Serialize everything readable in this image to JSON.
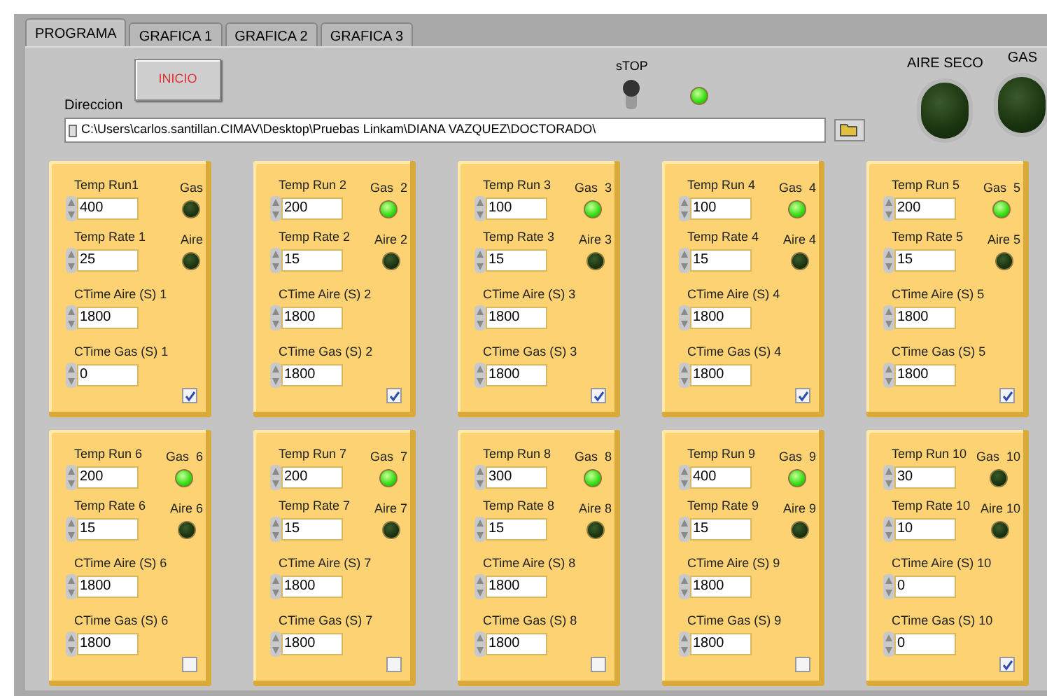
{
  "tabs": [
    {
      "label": "PROGRAMA",
      "selected": true
    },
    {
      "label": "GRAFICA 1",
      "selected": false
    },
    {
      "label": "GRAFICA 2",
      "selected": false
    },
    {
      "label": "GRAFICA 3",
      "selected": false
    }
  ],
  "start_button": "INICIO",
  "stop_switch": {
    "label": "sTOP",
    "on": false
  },
  "stop_led": {
    "on": true
  },
  "path": {
    "label": "Direccion",
    "value": "C:\\Users\\carlos.santillan.CIMAV\\Desktop\\Pruebas Linkam\\DIANA VAZQUEZ\\DOCTORADO\\"
  },
  "big_leds": [
    {
      "label": "AIRE SECO",
      "on": false
    },
    {
      "label": "GAS",
      "on": false
    }
  ],
  "runs": [
    {
      "fields": [
        {
          "label": "Temp Run1",
          "value": "400"
        },
        {
          "label": "Temp Rate 1",
          "value": "25"
        },
        {
          "label": "CTime Aire (S) 1",
          "value": "1800"
        },
        {
          "label": "CTime Gas (S) 1",
          "value": "0"
        }
      ],
      "gas": {
        "label": "Gas",
        "on": false
      },
      "aire": {
        "label": "Aire",
        "on": false
      },
      "checked": true
    },
    {
      "fields": [
        {
          "label": "Temp Run 2",
          "value": "200"
        },
        {
          "label": "Temp Rate 2",
          "value": "15"
        },
        {
          "label": "CTime Aire (S) 2",
          "value": "1800"
        },
        {
          "label": "CTime Gas (S) 2",
          "value": "1800"
        }
      ],
      "gas": {
        "label": "Gas  2",
        "on": true
      },
      "aire": {
        "label": "Aire 2",
        "on": false
      },
      "checked": true
    },
    {
      "fields": [
        {
          "label": "Temp Run 3",
          "value": "100"
        },
        {
          "label": "Temp Rate 3",
          "value": "15"
        },
        {
          "label": "CTime Aire (S) 3",
          "value": "1800"
        },
        {
          "label": "CTime Gas (S) 3",
          "value": "1800"
        }
      ],
      "gas": {
        "label": "Gas  3",
        "on": true
      },
      "aire": {
        "label": "Aire 3",
        "on": false
      },
      "checked": true
    },
    {
      "fields": [
        {
          "label": "Temp Run 4",
          "value": "100"
        },
        {
          "label": "Temp Rate 4",
          "value": "15"
        },
        {
          "label": "CTime Aire (S) 4",
          "value": "1800"
        },
        {
          "label": "CTime Gas (S) 4",
          "value": "1800"
        }
      ],
      "gas": {
        "label": "Gas  4",
        "on": true
      },
      "aire": {
        "label": "Aire 4",
        "on": false
      },
      "checked": true
    },
    {
      "fields": [
        {
          "label": "Temp Run 5",
          "value": "200"
        },
        {
          "label": "Temp Rate 5",
          "value": "15"
        },
        {
          "label": "CTime Aire (S) 5",
          "value": "1800"
        },
        {
          "label": "CTime Gas (S) 5",
          "value": "1800"
        }
      ],
      "gas": {
        "label": "Gas  5",
        "on": true
      },
      "aire": {
        "label": "Aire 5",
        "on": false
      },
      "checked": true
    },
    {
      "fields": [
        {
          "label": "Temp Run 6",
          "value": "200"
        },
        {
          "label": "Temp Rate 6",
          "value": "15"
        },
        {
          "label": "CTime Aire (S) 6",
          "value": "1800"
        },
        {
          "label": "CTime Gas (S) 6",
          "value": "1800"
        }
      ],
      "gas": {
        "label": "Gas  6",
        "on": true
      },
      "aire": {
        "label": "Aire 6",
        "on": false
      },
      "checked": false
    },
    {
      "fields": [
        {
          "label": "Temp Run 7",
          "value": "200"
        },
        {
          "label": "Temp Rate 7",
          "value": "15"
        },
        {
          "label": "CTime Aire (S) 7",
          "value": "1800"
        },
        {
          "label": "CTime Gas (S) 7",
          "value": "1800"
        }
      ],
      "gas": {
        "label": "Gas  7",
        "on": true
      },
      "aire": {
        "label": "Aire 7",
        "on": false
      },
      "checked": false
    },
    {
      "fields": [
        {
          "label": "Temp Run 8",
          "value": "300"
        },
        {
          "label": "Temp Rate 8",
          "value": "15"
        },
        {
          "label": "CTime Aire (S) 8",
          "value": "1800"
        },
        {
          "label": "CTime Gas (S) 8",
          "value": "1800"
        }
      ],
      "gas": {
        "label": "Gas  8",
        "on": true
      },
      "aire": {
        "label": "Aire 8",
        "on": false
      },
      "checked": false
    },
    {
      "fields": [
        {
          "label": "Temp Run 9",
          "value": "400"
        },
        {
          "label": "Temp Rate 9",
          "value": "15"
        },
        {
          "label": "CTime Aire (S) 9",
          "value": "1800"
        },
        {
          "label": "CTime Gas (S) 9",
          "value": "1800"
        }
      ],
      "gas": {
        "label": "Gas  9",
        "on": true
      },
      "aire": {
        "label": "Aire 9",
        "on": false
      },
      "checked": false
    },
    {
      "fields": [
        {
          "label": "Temp Run 10",
          "value": "30"
        },
        {
          "label": "Temp Rate 10",
          "value": "10"
        },
        {
          "label": "CTime Aire (S) 10",
          "value": "0"
        },
        {
          "label": "CTime Gas (S) 10",
          "value": "0"
        }
      ],
      "gas": {
        "label": "Gas  10",
        "on": false
      },
      "aire": {
        "label": "Aire 10",
        "on": false
      },
      "checked": true
    }
  ]
}
